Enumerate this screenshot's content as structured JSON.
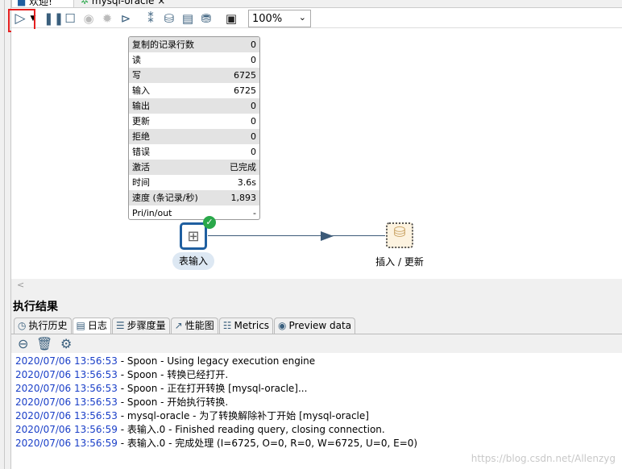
{
  "tabs": [
    {
      "label": "欢迎!"
    },
    {
      "label": "mysql-oracle",
      "close": "×"
    }
  ],
  "toolbar": {
    "zoom": "100%",
    "icons": [
      "run-icon",
      "dropdown-icon",
      "pause-icon",
      "stop-icon",
      "preview-icon",
      "debug-icon",
      "replay-icon",
      "verify-icon",
      "impact-icon",
      "sql-icon",
      "explore-db-icon",
      "grid-icon"
    ]
  },
  "stats": {
    "rows": [
      {
        "k": "复制的记录行数",
        "v": "0"
      },
      {
        "k": "读",
        "v": "0"
      },
      {
        "k": "写",
        "v": "6725"
      },
      {
        "k": "输入",
        "v": "6725"
      },
      {
        "k": "输出",
        "v": "0"
      },
      {
        "k": "更新",
        "v": "0"
      },
      {
        "k": "拒绝",
        "v": "0"
      },
      {
        "k": "错误",
        "v": "0"
      },
      {
        "k": "激活",
        "v": "已完成"
      },
      {
        "k": "时间",
        "v": "3.6s"
      },
      {
        "k": "速度 (条记录/秒)",
        "v": "1,893"
      },
      {
        "k": "Pri/in/out",
        "v": "-"
      }
    ]
  },
  "steps": {
    "input": "表输入",
    "output": "插入 / 更新"
  },
  "scroll_left": "<",
  "results": {
    "title": "执行结果",
    "tabs": [
      "执行历史",
      "日志",
      "步骤度量",
      "性能图",
      "Metrics",
      "Preview data"
    ],
    "active_tab": "日志"
  },
  "log": [
    {
      "ts": "2020/07/06 13:56:53",
      "msg": " - Spoon - Using legacy execution engine"
    },
    {
      "ts": "2020/07/06 13:56:53",
      "msg": " - Spoon - 转换已经打开."
    },
    {
      "ts": "2020/07/06 13:56:53",
      "msg": " - Spoon - 正在打开转换 [mysql-oracle]..."
    },
    {
      "ts": "2020/07/06 13:56:53",
      "msg": " - Spoon - 开始执行转换."
    },
    {
      "ts": "2020/07/06 13:56:53",
      "msg": " - mysql-oracle - 为了转换解除补丁开始  [mysql-oracle]"
    },
    {
      "ts": "2020/07/06 13:56:59",
      "msg": " - 表输入.0 - Finished reading query, closing connection."
    },
    {
      "ts": "2020/07/06 13:56:59",
      "msg": " - 表输入.0 - 完成处理 (I=6725, O=0, R=0, W=6725, U=0, E=0)"
    }
  ],
  "watermark": "https://blog.csdn.net/Allenzyg",
  "colors": {
    "timestamp": "#1a3fc8",
    "highlight": "#e52020",
    "success": "#2aa84a"
  }
}
